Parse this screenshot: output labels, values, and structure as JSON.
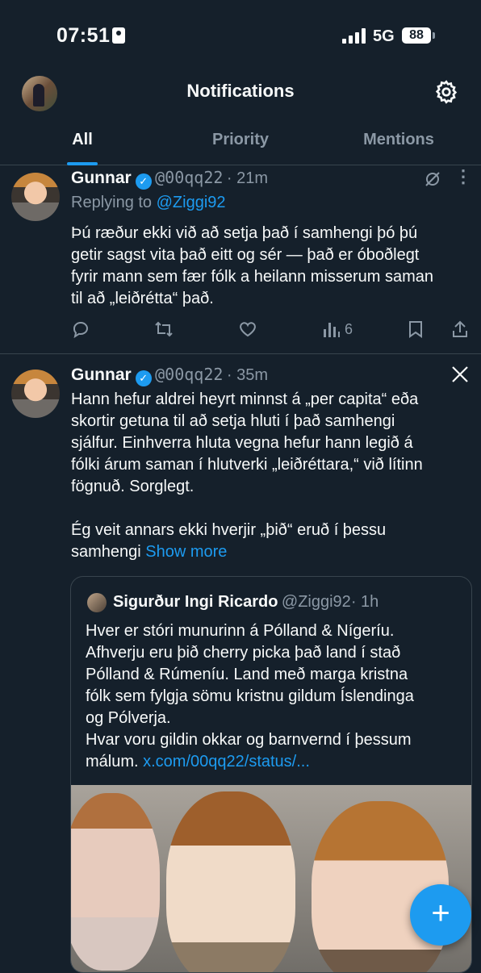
{
  "status": {
    "time": "07:51",
    "network": "5G",
    "battery": "88"
  },
  "header": {
    "title": "Notifications"
  },
  "tabs": [
    {
      "label": "All",
      "active": true
    },
    {
      "label": "Priority",
      "active": false
    },
    {
      "label": "Mentions",
      "active": false
    }
  ],
  "tweet1": {
    "name": "Gunnar",
    "handle": "@00qq22",
    "time": "· 21m",
    "replying_prefix": "Replying to ",
    "replying_to": "@Ziggi92",
    "lines": [
      "Þú ræður ekki við að setja það í samhengi þó þú",
      "getir sagst vita það eitt og sér — það er óboðlegt",
      "fyrir mann sem fær fólk a heilann misserum saman",
      "til að „leiðrétta“ það."
    ],
    "views": "6"
  },
  "tweet2": {
    "name": "Gunnar",
    "handle": "@00qq22",
    "time": "· 35m",
    "lines": [
      "Hann hefur aldrei heyrt minnst á „per capita“ eða",
      "skortir getuna til að setja hluti í það samhengi",
      "sjálfur. Einhverra hluta vegna hefur hann legið á",
      "fólki árum saman í hlutverki „leiðréttara,“ við lítinn",
      "fögnuð. Sorglegt."
    ],
    "line6": "Ég veit annars ekki hverjir „þið“ eruð í þessu",
    "line7": "samhengi",
    "show_more": "Show more"
  },
  "quote": {
    "name": "Sigurður Ingi Ricardo",
    "handle": "@Ziggi92",
    "time": "· 1h",
    "lines": [
      "Hver er stóri munurinn á Pólland & Nígeríu.",
      "Afhverju eru þið cherry picka það land í stað",
      "Pólland & Rúmeníu. Land með marga kristna",
      "fólk sem fylgja sömu kristnu gildum Íslendinga",
      "og Pólverja.",
      "Hvar voru gildin okkar og barnvernd í þessum"
    ],
    "last_prefix": "málum. ",
    "link": "x.com/00qq22/status/..."
  },
  "fab": {
    "label": "+"
  },
  "colors": {
    "background": "#15202b",
    "accent": "#1d9bf0",
    "muted": "#8b98a5"
  }
}
